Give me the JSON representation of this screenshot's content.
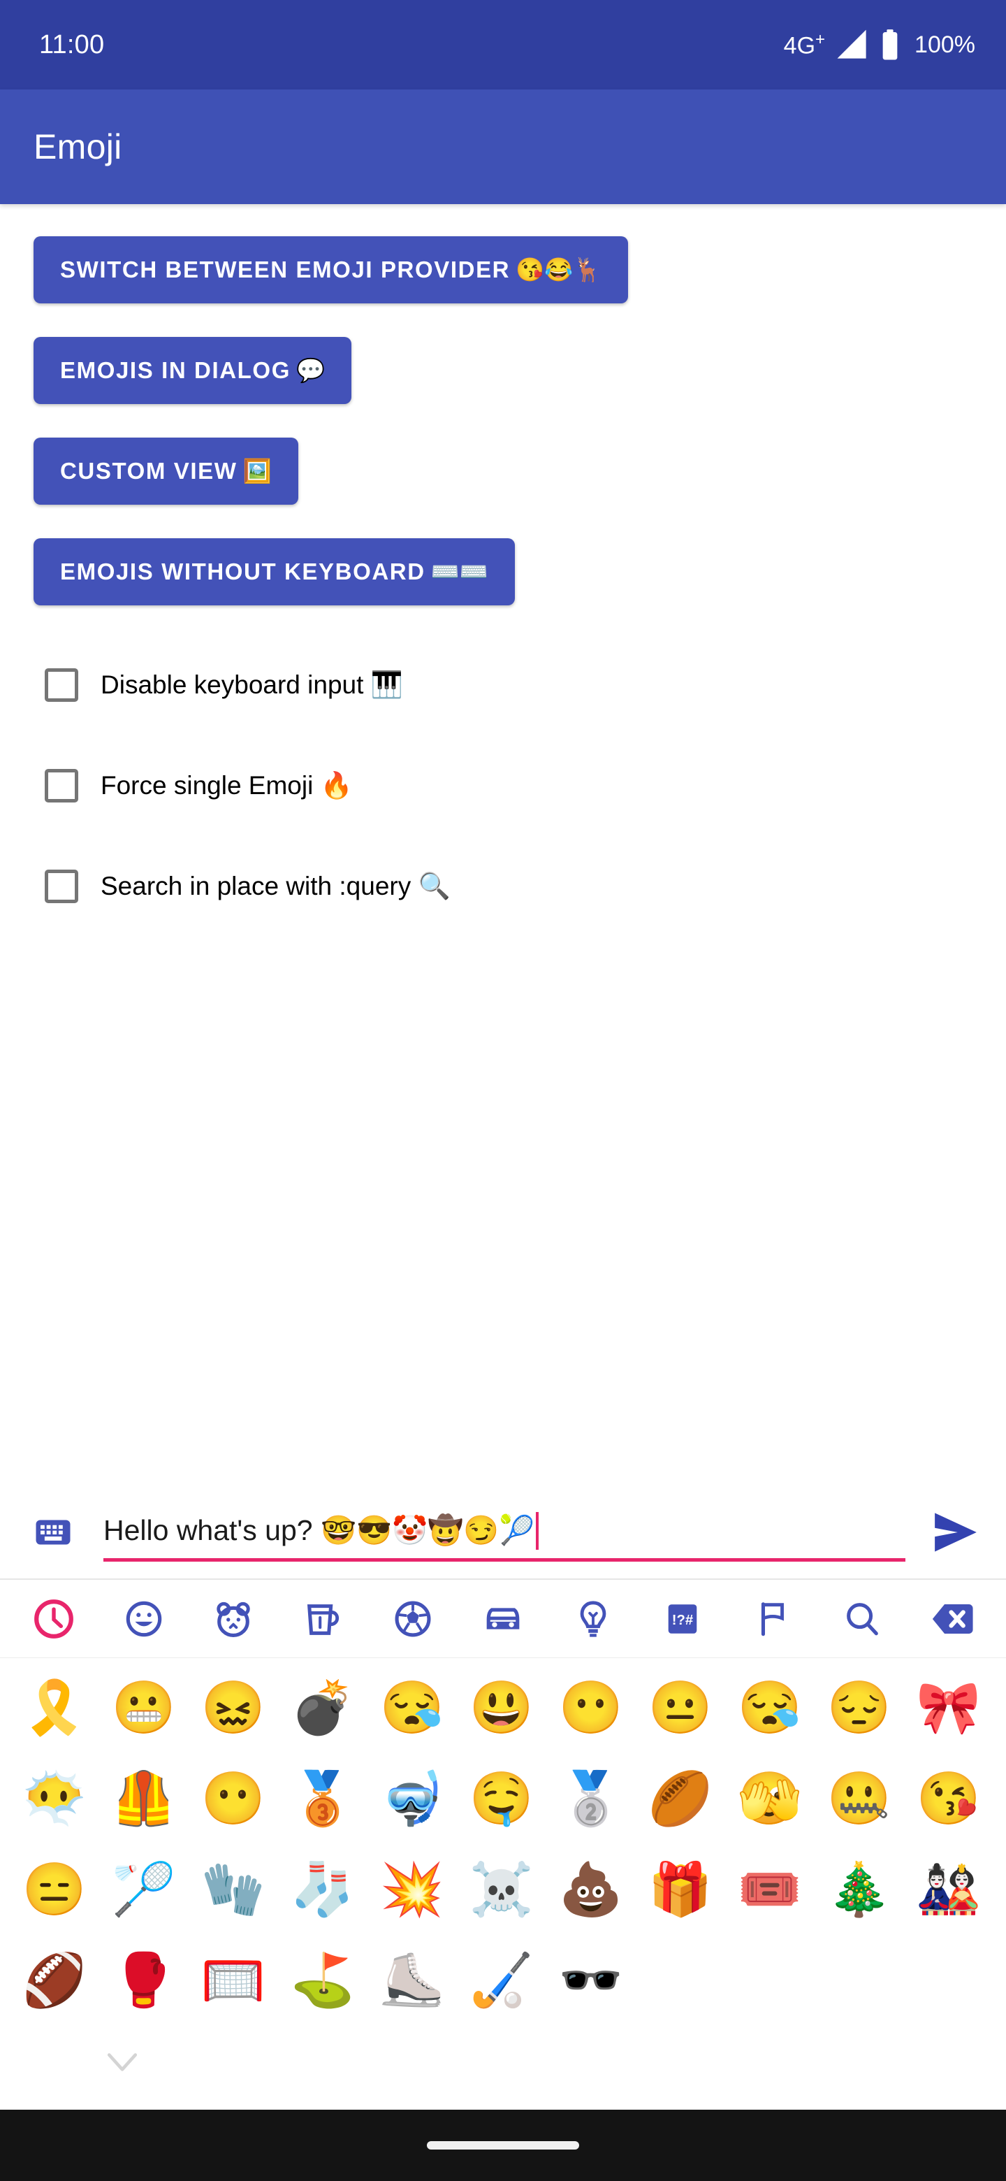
{
  "status_bar": {
    "clock": "11:00",
    "network_label": "4G",
    "network_plus": "+",
    "signal_icon": "signal-bars-icon",
    "battery_icon": "battery-full-icon",
    "battery_text": "100%",
    "background": "#303F9F"
  },
  "app_bar": {
    "title": "Emoji",
    "background": "#3F51B5"
  },
  "buttons": [
    {
      "label": "SWITCH BETWEEN EMOJI PROVIDER",
      "emoji": "😘😂🦌",
      "name": "switch-emoji-provider-button"
    },
    {
      "label": "EMOJIS IN DIALOG",
      "emoji": "💬",
      "name": "emojis-in-dialog-button"
    },
    {
      "label": "CUSTOM VIEW",
      "emoji": "🖼️",
      "name": "custom-view-button"
    },
    {
      "label": "EMOJIS WITHOUT KEYBOARD",
      "emoji": "⌨️⌨️",
      "name": "emojis-without-keyboard-button"
    }
  ],
  "button_color": "#4352B8",
  "checkboxes": [
    {
      "label": "Disable keyboard input 🎹",
      "checked": false,
      "name": "checkbox-disable-keyboard-input"
    },
    {
      "label": "Force single Emoji 🔥",
      "checked": false,
      "name": "checkbox-force-single-emoji"
    },
    {
      "label": "Search in place with :query 🔍",
      "checked": false,
      "name": "checkbox-search-in-place"
    }
  ],
  "input": {
    "text": "Hello what's up? 🤓😎🤡🤠😏🎾",
    "plain_text": "Hello what's up? ",
    "emoji_text": "🤓😎🤡🤠😏🎾",
    "placeholder": "",
    "underline_color": "#E8256B",
    "keyboard_toggle_icon": "keyboard-icon",
    "send_icon": "send-icon"
  },
  "emoji_keyboard": {
    "tabs": [
      {
        "name": "tab-recent",
        "icon": "clock-icon",
        "selected": true
      },
      {
        "name": "tab-smileys",
        "icon": "smiley-icon",
        "selected": false
      },
      {
        "name": "tab-animals",
        "icon": "animal-icon",
        "selected": false
      },
      {
        "name": "tab-food",
        "icon": "cup-icon",
        "selected": false
      },
      {
        "name": "tab-activities",
        "icon": "soccer-ball-icon",
        "selected": false
      },
      {
        "name": "tab-travel",
        "icon": "car-icon",
        "selected": false
      },
      {
        "name": "tab-objects",
        "icon": "lightbulb-icon",
        "selected": false
      },
      {
        "name": "tab-symbols",
        "icon": "symbols-icon",
        "selected": false
      },
      {
        "name": "tab-flags",
        "icon": "flag-icon",
        "selected": false
      },
      {
        "name": "tab-search",
        "icon": "search-icon",
        "selected": false
      },
      {
        "name": "tab-backspace",
        "icon": "backspace-icon",
        "selected": false
      }
    ],
    "selected_tab_color": "#E8256B",
    "tab_color": "#4352B8",
    "rows": [
      [
        "🎗️",
        "😬",
        "😖",
        "💣",
        "😪",
        "😃",
        "😶",
        "😐",
        "😪",
        "😔",
        "🎀"
      ],
      [
        "😶‍🌫️",
        "🦺",
        "😶",
        "🥉",
        "🤿",
        "🤤",
        "🥈",
        "🏉",
        "🫣",
        "🤐",
        "😘"
      ],
      [
        "😑",
        "🏸",
        "🧤",
        "🧦",
        "💥",
        "☠️",
        "💩",
        "🎁",
        "🎟️",
        "🎄",
        "🎎"
      ],
      [
        "🏈",
        "🥊",
        "🥅",
        "⛳",
        "⛸️",
        "🏑",
        "🕶️"
      ]
    ],
    "hide_keyboard_icon": "chevron-down-icon"
  },
  "nav_bar": {
    "gesture_pill": "home-gesture-pill",
    "background": "#141414"
  }
}
